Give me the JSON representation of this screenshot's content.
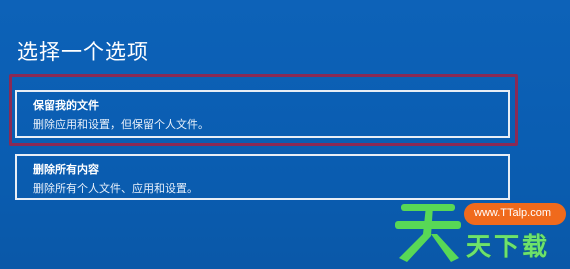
{
  "page": {
    "title": "选择一个选项"
  },
  "options": [
    {
      "title": "保留我的文件",
      "description": "删除应用和设置，但保留个人文件。"
    },
    {
      "title": "删除所有内容",
      "description": "删除所有个人文件、应用和设置。"
    }
  ],
  "watermark": {
    "url": "www.TTalp.com",
    "text": "天下载",
    "colors": {
      "pill": "#f06a1c",
      "text": "#6ee26b"
    }
  },
  "colors": {
    "background": "#0b5fb4",
    "highlight_frame": "#8a2a55",
    "option_border": "#e8eef6"
  }
}
